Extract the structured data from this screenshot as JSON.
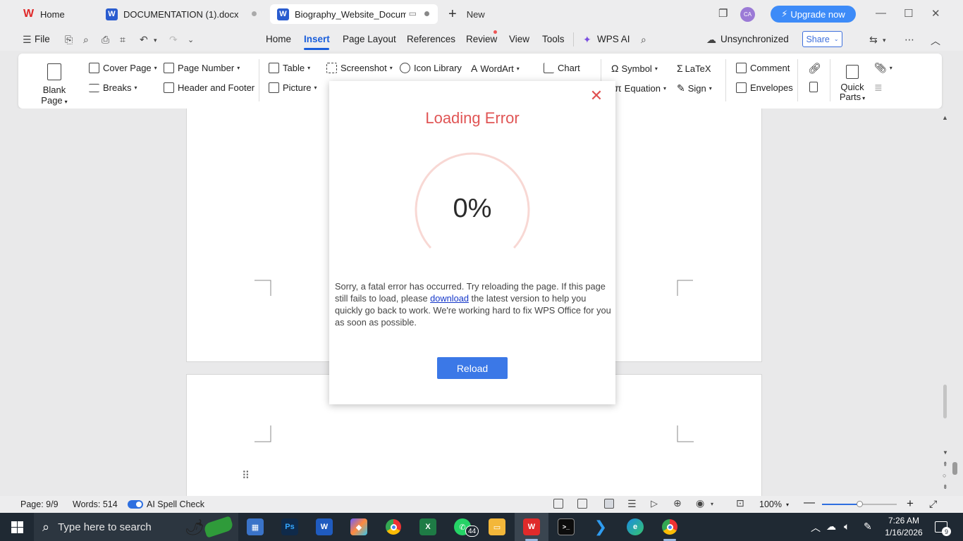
{
  "tabs": [
    {
      "label": "Home",
      "icon": "wps-logo-icon"
    },
    {
      "label": "DOCUMENTATION (1).docx",
      "icon": "word-doc-icon"
    },
    {
      "label": "Biography_Website_Documen",
      "icon": "word-doc-icon"
    }
  ],
  "new_tab_label": "New",
  "avatar_initials": "CA",
  "upgrade_label": "Upgrade now",
  "menu": {
    "file": "File",
    "items": [
      "Home",
      "Insert",
      "Page Layout",
      "References",
      "Review",
      "View",
      "Tools"
    ],
    "active": "Insert",
    "wps_ai": "WPS AI",
    "sync_status": "Unsynchronized",
    "share": "Share"
  },
  "ribbon": {
    "blank_page": "Blank Page",
    "cover_page": "Cover Page",
    "breaks": "Breaks",
    "page_number": "Page Number",
    "header_footer": "Header and  Footer",
    "table": "Table",
    "picture": "Picture",
    "screenshot": "Screenshot",
    "icon_library": "Icon  Library",
    "wordart": "WordArt",
    "chart": "Chart",
    "symbol": "Symbol",
    "equation": "Equation",
    "latex": "LaTeX",
    "sign": "Sign",
    "comment": "Comment",
    "envelopes": "Envelopes",
    "quick_parts_1": "Quick",
    "quick_parts_2": "Parts"
  },
  "modal": {
    "title": "Loading Error",
    "progress_text": "0%",
    "progress_value": 0,
    "message_before": "Sorry, a fatal error has occurred. Try reloading the page. If this page still fails to load, please ",
    "message_link": "download",
    "message_after": " the latest version to help you quickly go back to work. We're working hard to fix WPS Office for you as soon as possible.",
    "reload_label": "Reload",
    "accent_color": "#e05555",
    "button_color": "#3b78e7"
  },
  "status": {
    "page": "Page: 9/9",
    "words": "Words: 514",
    "spell_check": "AI Spell Check",
    "zoom": "100%"
  },
  "taskbar": {
    "search_placeholder": "Type here to search",
    "whatsapp_badge": "44",
    "time": "7:26 AM",
    "date": "1/16/2026",
    "notification_count": "9"
  }
}
